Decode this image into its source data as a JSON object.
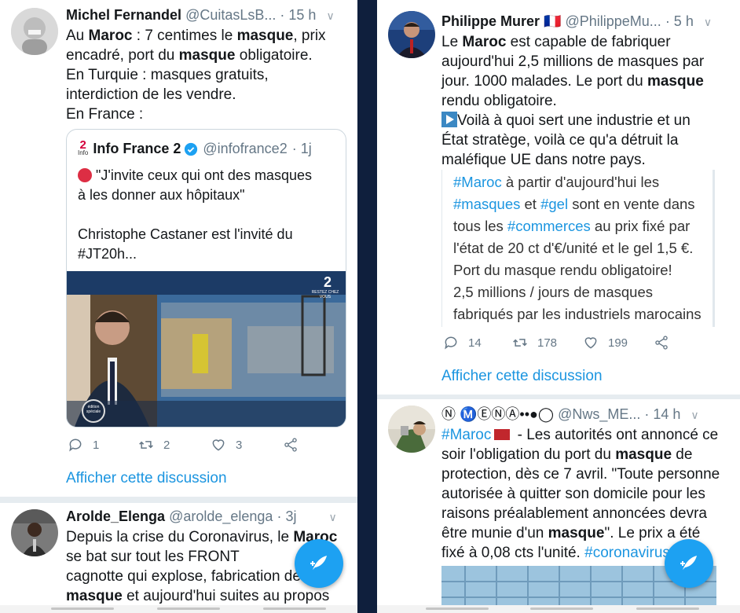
{
  "left": {
    "tweet1": {
      "name": "Michel Fernandel",
      "handle": "@CuitasLsB...",
      "time": "· 15 h",
      "line1_a": "Au ",
      "line1_b": "Maroc",
      "line1_c": " : 7 centimes le ",
      "line1_d": "masque",
      "line1_e": ", prix",
      "line2_a": "encadré, port du ",
      "line2_b": "masque",
      "line2_c": " obligatoire.",
      "line3": "En Turquie : masques gratuits,",
      "line4": "interdiction de les vendre.",
      "line5": "En France :",
      "quote": {
        "name": "Info France 2",
        "handle": "@infofrance2",
        "time": "· 1j",
        "logo_text": "2",
        "logo_sub": "Info",
        "line1": " \"J'invite ceux qui ont des masques",
        "line2": "à les donner aux hôpitaux\"",
        "line3": "Christophe Castaner est l'invité du",
        "line4": "#JT20h...",
        "media_logo": "2",
        "media_logo_sub": "RESTEZ CHEZ VOUS",
        "media_badge": "édition spéciale"
      },
      "replies": "1",
      "retweets": "2",
      "likes": "3",
      "show_thread": "Afficher cette discussion"
    },
    "tweet2": {
      "name": "Arolde_Elenga",
      "handle": "@arolde_elenga",
      "time": "· 3j",
      "line1_a": "Depuis la crise du Coronavirus, le ",
      "line1_b": "Maroc",
      "line2": "se bat sur tout les FRONT",
      "line3": "cagnotte qui explose, fabrication de",
      "line4_a": "masque",
      "line4_b": " et aujourd'hui suites au propos"
    }
  },
  "right": {
    "tweet1": {
      "name": "Philippe Murer",
      "flag": "🇫🇷",
      "handle": "@PhilippeMu...",
      "time": "· 5 h",
      "line1_a": "Le ",
      "line1_b": "Maroc",
      "line1_c": " est capable de fabriquer",
      "line2": "aujourd'hui 2,5 millions de masques par",
      "line3_a": "jour. 1000 malades. Le port du ",
      "line3_b": "masque",
      "line4": "rendu obligatoire.",
      "line5": "Voilà à quoi sert une industrie et un",
      "line6": "État stratège, voilà ce qu'a détruit la",
      "line7": "maléfique UE dans notre pays.",
      "embedded": {
        "l1_tag": "#Maroc",
        "l1": " à partir d'aujourd'hui les",
        "l2_tag1": "#masques",
        "l2_mid": " et ",
        "l2_tag2": "#gel",
        "l2_end": " sont en vente dans",
        "l3_a": "tous les ",
        "l3_tag": "#commerces",
        "l3_b": " au prix fixé par",
        "l4": "l'état de 20 ct d'€/unité et le gel 1,5 €.",
        "l5": "Port du masque rendu obligatoire!",
        "l6": "2,5 millions / jours de masques",
        "l7": "fabriqués par les industriels marocains"
      },
      "replies": "14",
      "retweets": "178",
      "likes": "199",
      "show_thread": "Afficher cette discussion"
    },
    "tweet2": {
      "name": "Ⓝ Ⓜ️Ⓔ️Ⓝ️Ⓐ️••●◯",
      "handle": "@Nws_ME...",
      "time": "· 14 h",
      "line1_tag": "#Maroc",
      "line1_rest": " - Les autorités ont annoncé ce",
      "line2_a": "soir l'obligation du port du ",
      "line2_b": "masque",
      "line2_c": " de",
      "line3": "protection, dès ce 7 avril. \"Toute personne",
      "line4": "autorisée à quitter son domicile pour les",
      "line5": "raisons préalablement annoncées devra",
      "line6_a": "être munie d'un ",
      "line6_b": "masque",
      "line6_c": "\". Le prix a été",
      "line7_a": "fixé à 0,08 cts l'unité. ",
      "line7_tag": "#coronavirus"
    }
  },
  "colors": {
    "accent": "#1b95e0",
    "fab": "#1da1f2",
    "divider": "#0f1f3d"
  }
}
